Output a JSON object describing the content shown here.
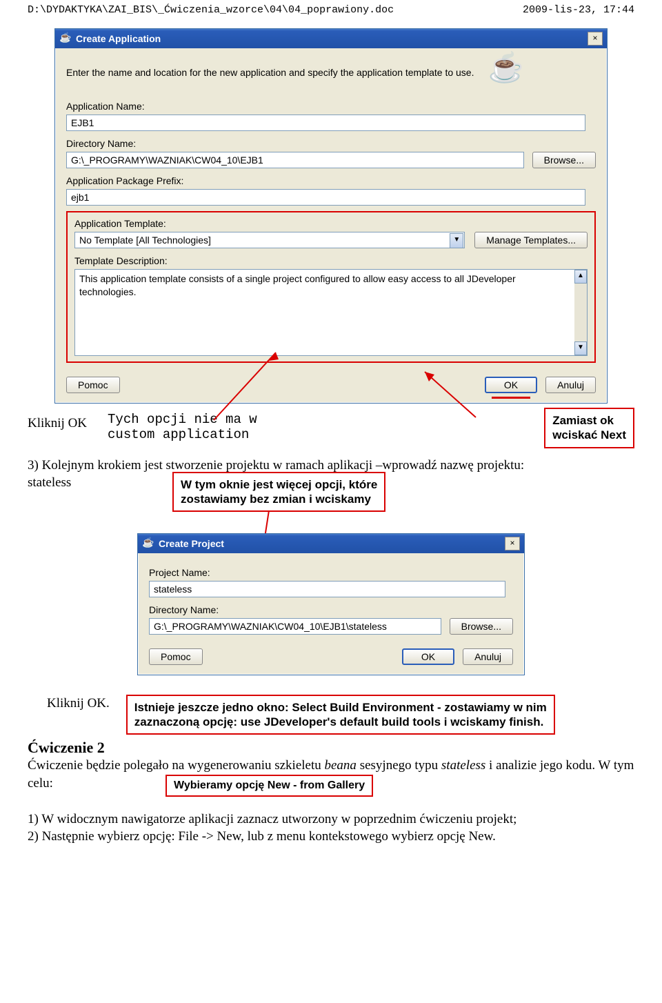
{
  "page": {
    "path": "D:\\DYDAKTYKA\\ZAI_BIS\\_Ćwiczenia_wzorce\\04\\04_poprawiony.doc",
    "timestamp": "2009-lis-23, 17:44"
  },
  "create_app": {
    "title": "Create Application",
    "close_icon": "×",
    "intro": "Enter the name and location for the new application and specify the application template to use.",
    "app_name_label": "Application Name:",
    "app_name": "EJB1",
    "dir_label": "Directory Name:",
    "dir": "G:\\_PROGRAMY\\WAZNIAK\\CW04_10\\EJB1",
    "browse": "Browse...",
    "pkg_label": "Application Package Prefix:",
    "pkg": "ejb1",
    "template_label": "Application Template:",
    "template_value": "No Template [All Technologies]",
    "manage": "Manage Templates...",
    "desc_label": "Template Description:",
    "desc": "This application template consists of a single project configured to allow easy access to all JDeveloper technologies.",
    "pomoc": "Pomoc",
    "ok": "OK",
    "anuluj": "Anuluj"
  },
  "annot1": {
    "click_ok": "Kliknij OK",
    "tych_line1": "Tych opcji nie ma w",
    "tych_line2": "custom application",
    "zamiast_line1": "Zamiast ok",
    "zamiast_line2": "wciskać Next"
  },
  "step3": "3) Kolejnym krokiem jest stworzenie projektu w ramach aplikacji –wprowadź nazwę projektu: stateless",
  "wiecej_line1": "W tym oknie jest więcej opcji, które",
  "wiecej_line2": "zostawiamy bez zmian i wciskamy",
  "create_proj": {
    "title": "Create Project",
    "close_icon": "×",
    "name_label": "Project Name:",
    "name": "stateless",
    "dir_label": "Directory Name:",
    "dir": "G:\\_PROGRAMY\\WAZNIAK\\CW04_10\\EJB1\\stateless",
    "browse": "Browse...",
    "pomoc": "Pomoc",
    "ok": "OK",
    "anuluj": "Anuluj"
  },
  "click_ok2": "Kliknij OK.",
  "istnieje_line1": "Istnieje jeszcze jedno okno: Select Build Environment - zostawiamy w nim",
  "istnieje_line2": "zaznaczoną opcję: use JDeveloper's default build tools i wciskamy finish.",
  "cw2": {
    "heading": "Ćwiczenie 2",
    "para_a": "Ćwiczenie będzie polegało na wygenerowaniu szkieletu ",
    "beana": "beana",
    "para_b": " sesyjnego typu ",
    "stateless": "stateless",
    "para_c": " i analizie jego kodu. W tym celu:",
    "wybieramy": "Wybieramy opcję New - from Gallery",
    "step1": "1) W widocznym nawigatorze aplikacji zaznacz utworzony w poprzednim ćwiczeniu projekt;",
    "step2": "2) Następnie wybierz opcję: File -> New, lub z menu kontekstowego wybierz opcję New."
  }
}
